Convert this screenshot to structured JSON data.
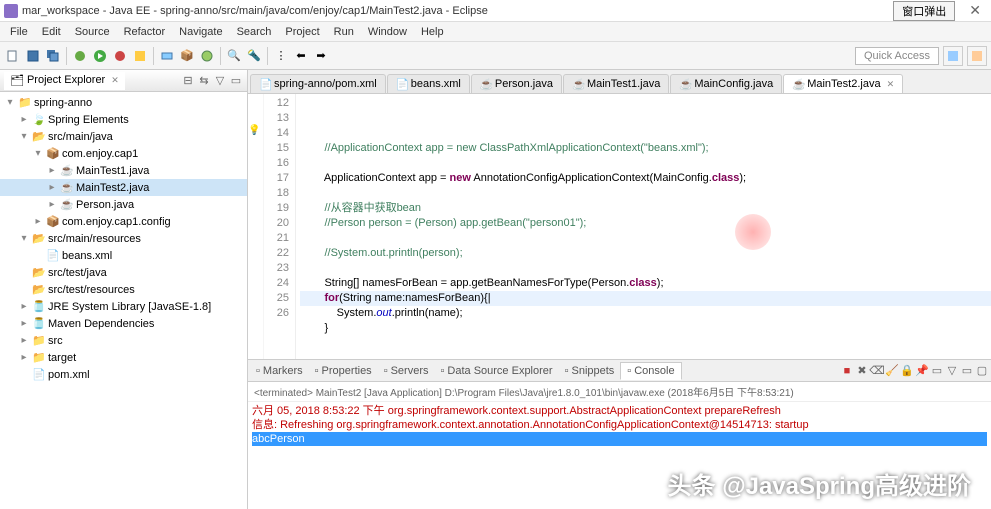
{
  "titlebar": {
    "text": "mar_workspace - Java EE - spring-anno/src/main/java/com/enjoy/cap1/MainTest2.java - Eclipse",
    "popup": "窗口弹出"
  },
  "menu": [
    "File",
    "Edit",
    "Source",
    "Refactor",
    "Navigate",
    "Search",
    "Project",
    "Run",
    "Window",
    "Help"
  ],
  "quick_access": "Quick Access",
  "project_explorer": {
    "title": "Project Explorer"
  },
  "tree": [
    {
      "d": 0,
      "tw": "▾",
      "ic": "proj",
      "t": "spring-anno"
    },
    {
      "d": 1,
      "tw": "▸",
      "ic": "spring",
      "t": "Spring Elements"
    },
    {
      "d": 1,
      "tw": "▾",
      "ic": "src",
      "t": "src/main/java"
    },
    {
      "d": 2,
      "tw": "▾",
      "ic": "pkg",
      "t": "com.enjoy.cap1"
    },
    {
      "d": 3,
      "tw": "▸",
      "ic": "java",
      "t": "MainTest1.java"
    },
    {
      "d": 3,
      "tw": "▸",
      "ic": "java",
      "t": "MainTest2.java",
      "sel": true
    },
    {
      "d": 3,
      "tw": "▸",
      "ic": "java",
      "t": "Person.java"
    },
    {
      "d": 2,
      "tw": "▸",
      "ic": "pkg",
      "t": "com.enjoy.cap1.config"
    },
    {
      "d": 1,
      "tw": "▾",
      "ic": "src",
      "t": "src/main/resources"
    },
    {
      "d": 2,
      "tw": "",
      "ic": "xml",
      "t": "beans.xml"
    },
    {
      "d": 1,
      "tw": "",
      "ic": "src",
      "t": "src/test/java"
    },
    {
      "d": 1,
      "tw": "",
      "ic": "src",
      "t": "src/test/resources"
    },
    {
      "d": 1,
      "tw": "▸",
      "ic": "jar",
      "t": "JRE System Library [JavaSE-1.8]"
    },
    {
      "d": 1,
      "tw": "▸",
      "ic": "jar",
      "t": "Maven Dependencies"
    },
    {
      "d": 1,
      "tw": "▸",
      "ic": "fld",
      "t": "src"
    },
    {
      "d": 1,
      "tw": "▸",
      "ic": "fld",
      "t": "target"
    },
    {
      "d": 1,
      "tw": "",
      "ic": "xml",
      "t": "pom.xml"
    }
  ],
  "editor_tabs": [
    {
      "label": "spring-anno/pom.xml",
      "ic": "xml"
    },
    {
      "label": "beans.xml",
      "ic": "xml"
    },
    {
      "label": "Person.java",
      "ic": "java"
    },
    {
      "label": "MainTest1.java",
      "ic": "java"
    },
    {
      "label": "MainConfig.java",
      "ic": "java"
    },
    {
      "label": "MainTest2.java",
      "ic": "java",
      "active": true
    }
  ],
  "code": {
    "start": 12,
    "lines": [
      {
        "n": 12,
        "html": "        <span class='cm'>//ApplicationContext app = new ClassPathXmlApplicationContext(\"beans.xml\");</span>"
      },
      {
        "n": 13,
        "html": ""
      },
      {
        "n": 14,
        "html": "        ApplicationContext app = <span class='kw'>new</span> AnnotationConfigApplicationContext(MainConfig.<span class='kw'>class</span>);",
        "marker": "bulb"
      },
      {
        "n": 15,
        "html": ""
      },
      {
        "n": 16,
        "html": "        <span class='cm'>//从容器中获取bean</span>"
      },
      {
        "n": 17,
        "html": "        <span class='cm'>//Person person = (Person) app.getBean(\"person01\");</span>"
      },
      {
        "n": 18,
        "html": ""
      },
      {
        "n": 19,
        "html": "        <span class='cm'>//System.out.println(person);</span>"
      },
      {
        "n": 20,
        "html": ""
      },
      {
        "n": 21,
        "html": "        String[] namesForBean = app.getBeanNamesForType(Person.<span class='kw'>class</span>);"
      },
      {
        "n": 22,
        "html": "        <span class='kw'>for</span>(String name:namesForBean){|",
        "current": true
      },
      {
        "n": 23,
        "html": "            System.<span class='fd'>out</span>.println(name);"
      },
      {
        "n": 24,
        "html": "        }"
      },
      {
        "n": 25,
        "html": ""
      },
      {
        "n": 26,
        "html": ""
      }
    ]
  },
  "console_tabs": [
    "Markers",
    "Properties",
    "Servers",
    "Data Source Explorer",
    "Snippets",
    "Console"
  ],
  "console_active": "Console",
  "console_header": "<terminated> MainTest2 [Java Application] D:\\Program Files\\Java\\jre1.8.0_101\\bin\\javaw.exe (2018年6月5日 下午8:53:21)",
  "console_out": [
    {
      "cls": "out-red",
      "t": "六月 05, 2018 8:53:22 下午 org.springframework.context.support.AbstractApplicationContext prepareRefresh"
    },
    {
      "cls": "out-red",
      "t": "信息: Refreshing org.springframework.context.annotation.AnnotationConfigApplicationContext@14514713: startup"
    },
    {
      "cls": "out-sel",
      "t": "abcPerson"
    }
  ],
  "watermark": "头条 @JavaSpring高级进阶"
}
